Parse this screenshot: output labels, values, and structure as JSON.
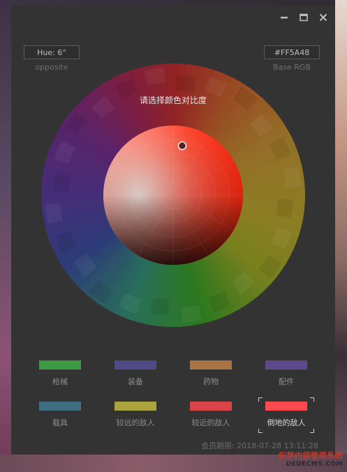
{
  "window": {
    "controls": [
      "minimize-icon",
      "maximize-icon",
      "close-icon"
    ]
  },
  "hue_field": {
    "value": "Hue: 6°",
    "label": "opposite"
  },
  "rgb_field": {
    "value": "#FF5A48",
    "label": "Base RGB"
  },
  "wheel": {
    "title": "请选择颜色对比度",
    "hue_degrees": 6
  },
  "swatches": [
    {
      "label": "枪械",
      "color": "#3e9a45"
    },
    {
      "label": "装备",
      "color": "#4e4a86"
    },
    {
      "label": "药物",
      "color": "#a87446"
    },
    {
      "label": "配件",
      "color": "#5c4a8c"
    },
    {
      "label": "载具",
      "color": "#3f6f80"
    },
    {
      "label": "较远的敌人",
      "color": "#a9a43e"
    },
    {
      "label": "较近的敌人",
      "color": "#d84448"
    },
    {
      "label": "倒地的敌人",
      "color": "#ff4b4e"
    }
  ],
  "member": {
    "text": "会员期限: 2018-07-28 13:11:28"
  },
  "watermark": {
    "line1": "织梦内容管理系统",
    "line2": "DEDECMS.COM"
  },
  "colors": {
    "panel_bg": "#333333",
    "accent": "#FF5A48"
  }
}
